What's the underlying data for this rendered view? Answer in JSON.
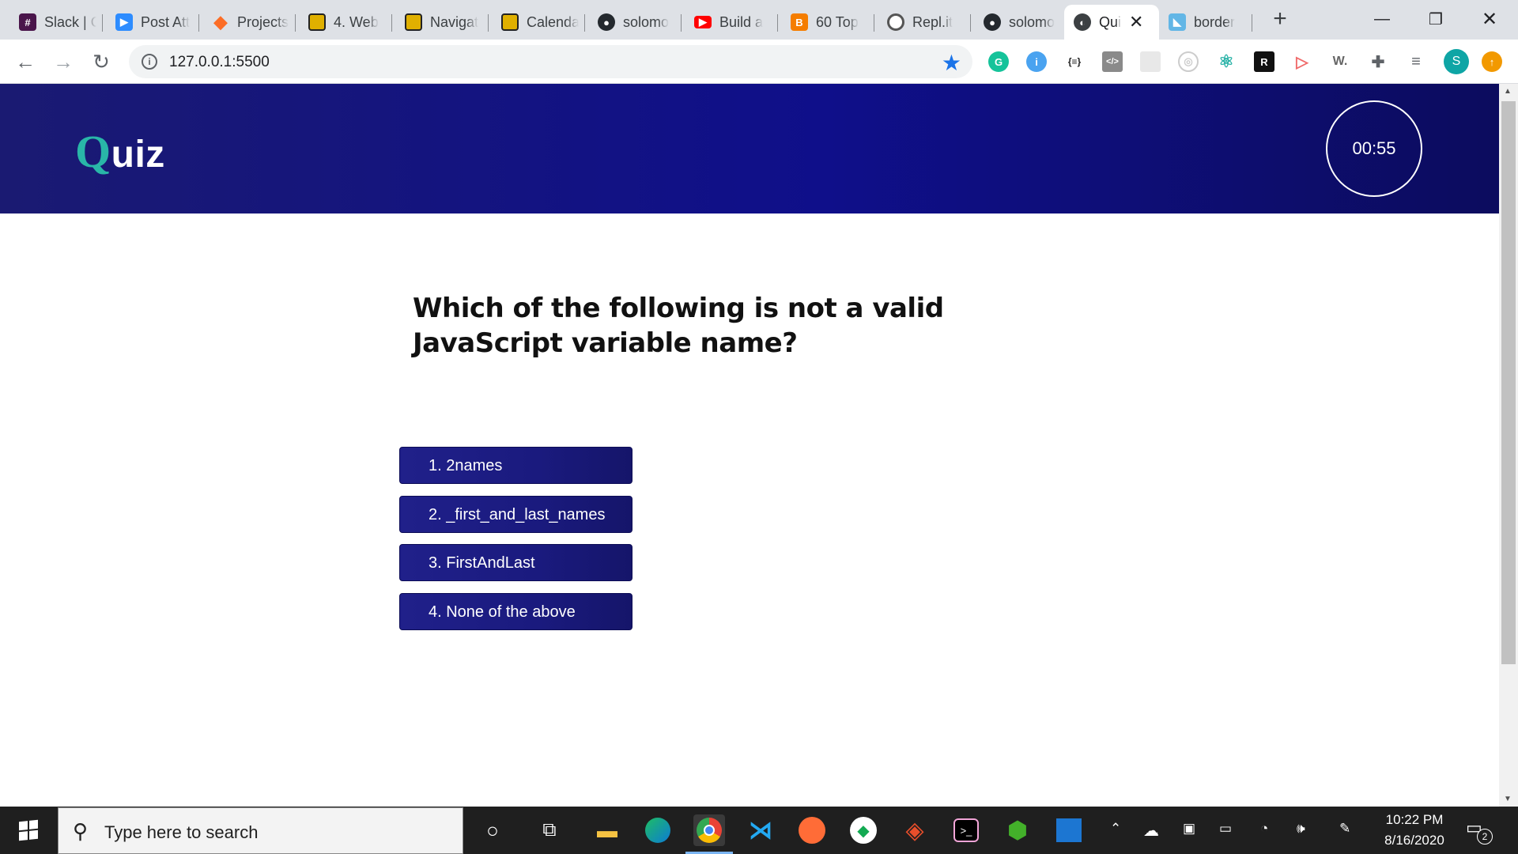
{
  "browser": {
    "tabs": [
      {
        "label": "Slack | C",
        "icon": "slack-icon"
      },
      {
        "label": "Post Att",
        "icon": "zoom-icon"
      },
      {
        "label": "Projects",
        "icon": "gitlab-icon"
      },
      {
        "label": "4. Web",
        "icon": "learn-icon"
      },
      {
        "label": "Navigat",
        "icon": "learn-icon"
      },
      {
        "label": "Calenda",
        "icon": "learn-icon"
      },
      {
        "label": "solomo",
        "icon": "github-icon"
      },
      {
        "label": "Build a",
        "icon": "youtube-icon"
      },
      {
        "label": "60 Top",
        "icon": "blogger-icon"
      },
      {
        "label": "Repl.it",
        "icon": "replit-icon"
      },
      {
        "label": "solomo",
        "icon": "github-icon"
      },
      {
        "label": "Qui",
        "icon": "globe-icon",
        "active": true
      },
      {
        "label": "border",
        "icon": "bird-icon"
      }
    ],
    "url": "127.0.0.1:5500",
    "profile_initial": "S"
  },
  "quiz": {
    "logo_first": "Q",
    "logo_rest": "uiz",
    "timer": "00:55",
    "question": "Which of the following is not a valid JavaScript variable name?",
    "answers": [
      "1. 2names",
      "2. _first_and_last_names",
      "3. FirstAndLast",
      "4. None of the above"
    ]
  },
  "taskbar": {
    "search_placeholder": "Type here to search",
    "time": "10:22 PM",
    "date": "8/16/2020",
    "notification_count": "2"
  },
  "colors": {
    "header_bg": "#0f0f8a",
    "logo_accent": "#29b6a8",
    "answer_bg": "#1a1a7e"
  }
}
